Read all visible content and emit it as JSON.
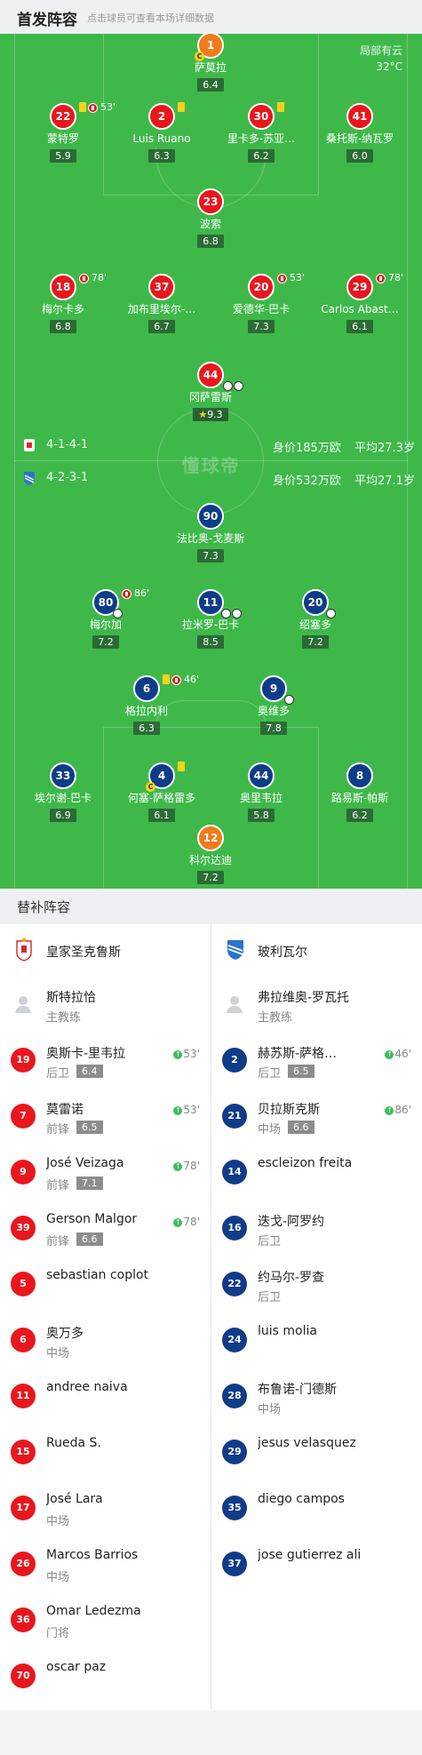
{
  "header": {
    "title": "首发阵容",
    "subtitle": "点击球员可查看本场详细数据"
  },
  "weather": {
    "condition": "局部有云",
    "temp": "32°C"
  },
  "watermark": "懂球帝",
  "home_formation": {
    "formation": "4-1-4-1",
    "value": "身价185万欧",
    "avg_age": "平均27.3岁"
  },
  "away_formation": {
    "formation": "4-2-3-1",
    "value": "身价532万欧",
    "avg_age": "平均27.1岁"
  },
  "home_players": [
    {
      "num": "1",
      "name": "萨莫拉",
      "rating": "6.4"
    },
    {
      "num": "22",
      "name": "蒙特罗",
      "rating": "5.9",
      "minute": "53'"
    },
    {
      "num": "2",
      "name": "Luis Ruano",
      "rating": "6.3"
    },
    {
      "num": "30",
      "name": "里卡多-苏亚…",
      "rating": "6.2"
    },
    {
      "num": "41",
      "name": "桑托斯-纳瓦罗",
      "rating": "6.0"
    },
    {
      "num": "23",
      "name": "波索",
      "rating": "6.8"
    },
    {
      "num": "18",
      "name": "梅尔卡多",
      "rating": "6.8",
      "minute": "78'"
    },
    {
      "num": "37",
      "name": "加布里埃尔-…",
      "rating": "6.7"
    },
    {
      "num": "20",
      "name": "爱德华-巴卡",
      "rating": "7.3",
      "minute": "53'"
    },
    {
      "num": "29",
      "name": "Carlos Abast…",
      "rating": "6.1",
      "minute": "78'"
    },
    {
      "num": "44",
      "name": "冈萨雷斯",
      "rating": "9.3"
    }
  ],
  "away_players": [
    {
      "num": "90",
      "name": "法比奥-戈麦斯",
      "rating": "7.3"
    },
    {
      "num": "80",
      "name": "梅尔加",
      "rating": "7.2",
      "minute": "86'"
    },
    {
      "num": "11",
      "name": "拉米罗-巴卡",
      "rating": "8.5"
    },
    {
      "num": "20",
      "name": "绍塞多",
      "rating": "7.2"
    },
    {
      "num": "6",
      "name": "格拉内利",
      "rating": "6.3",
      "minute": "46'"
    },
    {
      "num": "9",
      "name": "奥维多",
      "rating": "7.8"
    },
    {
      "num": "33",
      "name": "埃尔谢-巴卡",
      "rating": "6.9"
    },
    {
      "num": "4",
      "name": "何塞-萨格雷多",
      "rating": "6.1"
    },
    {
      "num": "44",
      "name": "奥里韦拉",
      "rating": "5.8"
    },
    {
      "num": "8",
      "name": "路易斯-帕斯",
      "rating": "6.2"
    },
    {
      "num": "12",
      "name": "科尔达迪",
      "rating": "7.2"
    }
  ],
  "subs_title": "替补阵容",
  "home_team": {
    "name": "皇家圣克鲁斯",
    "coach": "斯特拉恰",
    "coach_label": "主教练"
  },
  "away_team": {
    "name": "玻利瓦尔",
    "coach": "弗拉维奥-罗瓦托",
    "coach_label": "主教练"
  },
  "home_subs": [
    {
      "num": "19",
      "name": "奥斯卡-里韦拉",
      "pos": "后卫",
      "rating": "6.4",
      "in": "53'"
    },
    {
      "num": "7",
      "name": "莫雷诺",
      "pos": "前锋",
      "rating": "6.5",
      "in": "53'"
    },
    {
      "num": "9",
      "name": "José Veizaga",
      "pos": "前锋",
      "rating": "7.1",
      "in": "78'"
    },
    {
      "num": "39",
      "name": "Gerson Malgor",
      "pos": "前锋",
      "rating": "6.6",
      "in": "78'"
    },
    {
      "num": "5",
      "name": "sebastian coplot",
      "pos": "",
      "rating": "",
      "in": ""
    },
    {
      "num": "6",
      "name": "奥万多",
      "pos": "中场",
      "rating": "",
      "in": ""
    },
    {
      "num": "11",
      "name": "andree naiva",
      "pos": "",
      "rating": "",
      "in": ""
    },
    {
      "num": "15",
      "name": "Rueda S.",
      "pos": "",
      "rating": "",
      "in": ""
    },
    {
      "num": "17",
      "name": "José Lara",
      "pos": "中场",
      "rating": "",
      "in": ""
    },
    {
      "num": "26",
      "name": "Marcos Barrios",
      "pos": "中场",
      "rating": "",
      "in": ""
    },
    {
      "num": "36",
      "name": "Omar Ledezma",
      "pos": "门将",
      "rating": "",
      "in": ""
    },
    {
      "num": "70",
      "name": "oscar paz",
      "pos": "",
      "rating": "",
      "in": ""
    }
  ],
  "away_subs": [
    {
      "num": "2",
      "name": "赫苏斯-萨格…",
      "pos": "后卫",
      "rating": "6.5",
      "in": "46'"
    },
    {
      "num": "21",
      "name": "贝拉斯克斯",
      "pos": "中场",
      "rating": "6.6",
      "in": "86'"
    },
    {
      "num": "14",
      "name": "escleizon freita",
      "pos": "",
      "rating": "",
      "in": ""
    },
    {
      "num": "16",
      "name": "迭戈-阿罗约",
      "pos": "后卫",
      "rating": "",
      "in": ""
    },
    {
      "num": "22",
      "name": "约马尔-罗查",
      "pos": "后卫",
      "rating": "",
      "in": ""
    },
    {
      "num": "24",
      "name": "luis molia",
      "pos": "",
      "rating": "",
      "in": ""
    },
    {
      "num": "28",
      "name": "布鲁诺-门德斯",
      "pos": "中场",
      "rating": "",
      "in": ""
    },
    {
      "num": "29",
      "name": "jesus velasquez",
      "pos": "",
      "rating": "",
      "in": ""
    },
    {
      "num": "35",
      "name": "diego campos",
      "pos": "",
      "rating": "",
      "in": ""
    },
    {
      "num": "37",
      "name": "jose gutierrez ali",
      "pos": "",
      "rating": "",
      "in": ""
    }
  ]
}
